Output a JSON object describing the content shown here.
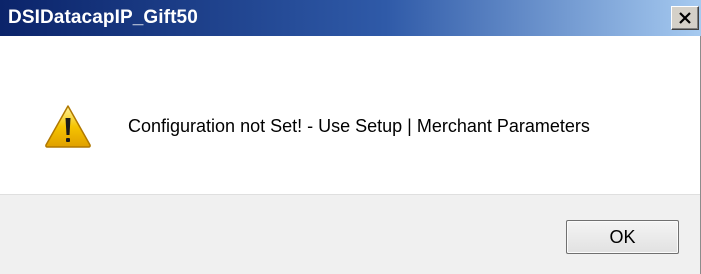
{
  "window": {
    "title": "DSIDatacapIP_Gift50",
    "close_glyph": "X"
  },
  "dialog": {
    "icon": "warning-icon",
    "message": "Configuration not Set! - Use Setup | Merchant Parameters",
    "ok_label": "OK"
  },
  "colors": {
    "titlebar_start": "#0b246a",
    "titlebar_end": "#a6caf0",
    "warning_yellow": "#f5c400",
    "footer_bg": "#f0f0f0"
  }
}
